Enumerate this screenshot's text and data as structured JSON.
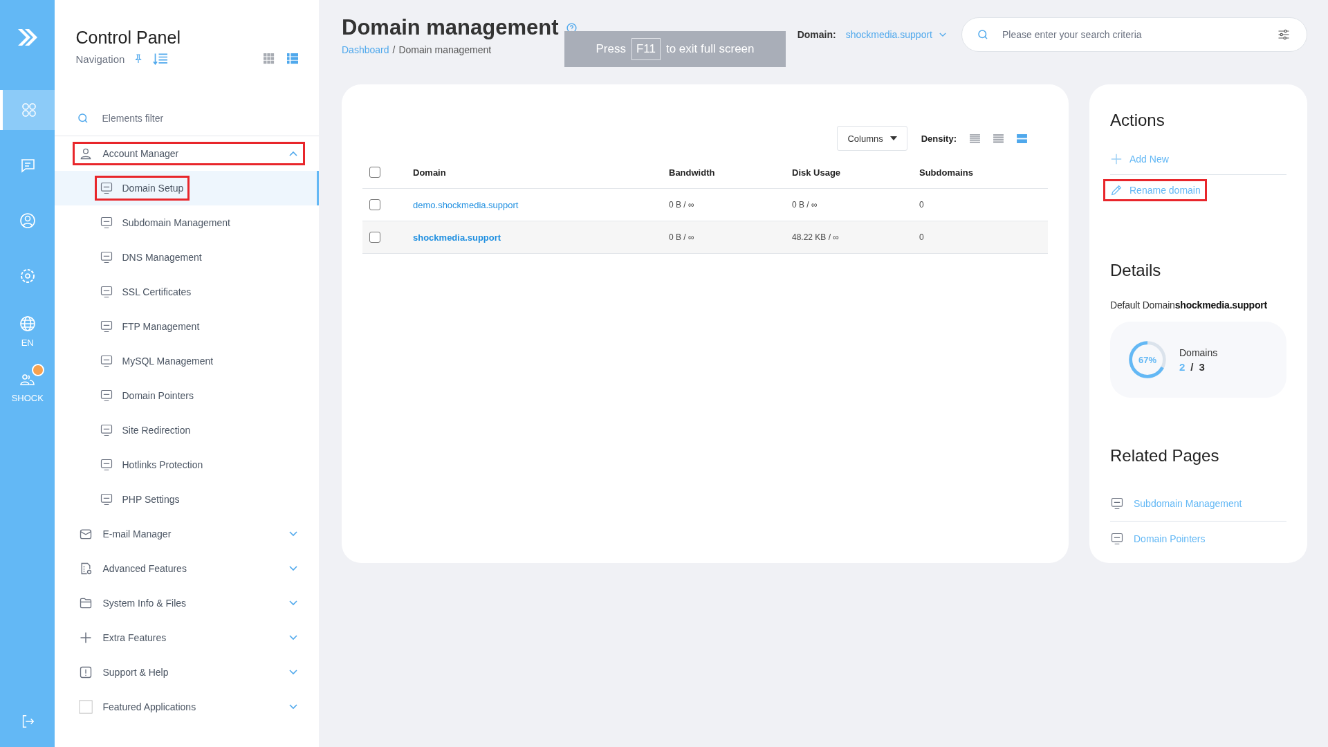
{
  "rail": {
    "items": [
      {
        "selected": true
      },
      {
        "selected": false
      },
      {
        "selected": false
      },
      {
        "selected": false
      },
      {
        "label": "EN",
        "selected": false
      },
      {
        "label": "SHOCK",
        "selected": false,
        "notification": true
      }
    ]
  },
  "sidebar": {
    "title": "Control Panel",
    "subtitle": "Navigation",
    "view_modes": [
      {
        "selected": false
      },
      {
        "selected": true
      }
    ],
    "filter": {
      "placeholder": "Elements filter"
    },
    "groups": [
      {
        "label": "Account Manager",
        "expanded": true,
        "highlighted": true,
        "children": [
          {
            "label": "Domain Setup",
            "selected": true,
            "highlighted": true
          },
          {
            "label": "Subdomain Management",
            "selected": false,
            "highlighted": false
          },
          {
            "label": "DNS Management",
            "selected": false,
            "highlighted": false
          },
          {
            "label": "SSL Certificates",
            "selected": false,
            "highlighted": false
          },
          {
            "label": "FTP Management",
            "selected": false,
            "highlighted": false
          },
          {
            "label": "MySQL Management",
            "selected": false,
            "highlighted": false
          },
          {
            "label": "Domain Pointers",
            "selected": false,
            "highlighted": false
          },
          {
            "label": "Site Redirection",
            "selected": false,
            "highlighted": false
          },
          {
            "label": "Hotlinks Protection",
            "selected": false,
            "highlighted": false
          },
          {
            "label": "PHP Settings",
            "selected": false,
            "highlighted": false
          }
        ]
      },
      {
        "label": "E-mail Manager",
        "expanded": false,
        "highlighted": false
      },
      {
        "label": "Advanced Features",
        "expanded": false,
        "highlighted": false
      },
      {
        "label": "System Info & Files",
        "expanded": false,
        "highlighted": false
      },
      {
        "label": "Extra Features",
        "expanded": false,
        "highlighted": false
      },
      {
        "label": "Support & Help",
        "expanded": false,
        "highlighted": false
      },
      {
        "label": "Featured Applications",
        "expanded": false,
        "highlighted": false
      }
    ]
  },
  "header": {
    "title": "Domain management",
    "breadcrumb": {
      "items": [
        "Dashboard",
        "Domain management"
      ],
      "separator": "/"
    },
    "toast": {
      "before": "Press",
      "key": "F11",
      "after": "to exit full screen"
    },
    "domain_selector": {
      "label": "Domain:",
      "value": "shockmedia.support"
    },
    "search": {
      "placeholder": "Please enter your search criteria"
    }
  },
  "table": {
    "select_all": {
      "checked": false
    },
    "columns_button": "Columns",
    "density_label": "Density:",
    "density": [
      {
        "selected": false
      },
      {
        "selected": false
      },
      {
        "selected": true
      }
    ],
    "columns": [
      "Domain",
      "Bandwidth",
      "Disk Usage",
      "Subdomains"
    ],
    "rows": [
      {
        "checked": false,
        "hovered": false,
        "cells": [
          "demo.shockmedia.support",
          "0 B / ∞",
          "0 B / ∞",
          "0"
        ]
      },
      {
        "checked": false,
        "hovered": true,
        "cells": [
          "shockmedia.support",
          "0 B / ∞",
          "48.22 KB / ∞",
          "0"
        ]
      }
    ]
  },
  "actions": {
    "title": "Actions",
    "items": [
      {
        "kind": "add",
        "label": "Add New",
        "highlighted": false
      },
      {
        "kind": "rename",
        "label": "Rename domain",
        "highlighted": true
      }
    ]
  },
  "details": {
    "title": "Details",
    "default_domain": "Default Domain**shockmedia.support**",
    "quota": {
      "label": "Domains",
      "percent": "67%",
      "level": 0.67,
      "used": "2",
      "separator": "/",
      "total": "3"
    }
  },
  "related": {
    "title": "Related Pages",
    "items": [
      "Subdomain Management",
      "Domain Pointers"
    ]
  }
}
